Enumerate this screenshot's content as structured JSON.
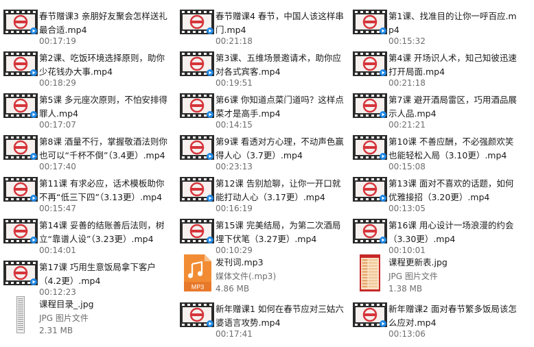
{
  "window": {
    "view": "large-icons"
  },
  "colors": {
    "text": "#1a1a1a",
    "meta": "#6d6d6d",
    "film": "#2a2a2a",
    "mp3": "#e8792a",
    "accent": "#d6343a"
  },
  "videos": [
    {
      "name": "春节赠课3 亲朋好友聚会怎样送礼最合适.mp4",
      "duration": "00:17:19"
    },
    {
      "name": "春节赠课4 春节，中国人该这样串门.mp4",
      "duration": "00:21:18"
    },
    {
      "name": "第1课、找准目的让你一呼百应.mp4",
      "duration": "00:15:32"
    },
    {
      "name": "第2课、吃饭环境选择原则，助你少花钱办大事.mp4",
      "duration": "00:18:29"
    },
    {
      "name": "第3课、五维场景邀请术，助你应对各式宾客.mp4",
      "duration": "00:19:51"
    },
    {
      "name": "第4课 开场识人术，知己知彼迅速打开局面.mp4",
      "duration": "00:21:18"
    },
    {
      "name": "第5课 多元座次原则，不怕安排得罪人.mp4",
      "duration": "00:17:07"
    },
    {
      "name": "第6课 你知道点菜门道吗？这样点菜才是高手.mp4",
      "duration": "00:14:15"
    },
    {
      "name": "第7课 避开酒局雷区，巧用酒品展示人品.mp4",
      "duration": "00:21:21"
    },
    {
      "name": "第8课 酒量不行，掌握敬酒法则你也可以“千杯不倒”（3.4更）.mp4",
      "duration": "00:17:40"
    },
    {
      "name": "第9课 看透对方心理，不动声色赢得人心（3.7更）.mp4",
      "duration": "00:23:13"
    },
    {
      "name": "第10课 不善应酬，不必强颜欢笑也能轻松入局（3.10更）.mp4",
      "duration": "00:15:08"
    },
    {
      "name": "第11课 有求必应，话术模板助你不再“低三下四”（3.13更）.mp4",
      "duration": "00:15:47"
    },
    {
      "name": "第12课 告别尬聊，让你一开口就能打动人心（3.17更）.mp4",
      "duration": "00:16:19"
    },
    {
      "name": "第13课 面对不喜欢的话题，如何优雅接招（3.20更）.mp4",
      "duration": "00:13:05"
    },
    {
      "name": "第14课 妥善的结账善后法则，树立“靠谱人设”（3.23更）.mp4",
      "duration": "00:14:01"
    },
    {
      "name": "第15课 完美结局，为第二次酒局埋下伏笔（3.27更）.mp4",
      "duration": "00:10:29"
    },
    {
      "name": "第16课 用心设计一场浪漫的约会（3.30更）.mp4",
      "duration": "00:10:01"
    },
    {
      "name": "第17课 巧用生意饭局拿下客户（4.2更）.mp4",
      "duration": "00:12:23"
    }
  ],
  "files": [
    {
      "name": "发刊词.mp3",
      "type": "媒体文件(.mp3)",
      "size": "4.86 MB",
      "icon": "mp3-icon",
      "badge": "MP3"
    },
    {
      "name": "课程更新表.jpg",
      "type": "JPG 图片文件",
      "size": "1.38 MB",
      "icon": "image-schedule-icon"
    },
    {
      "name": "课程目录_.jpg",
      "type": "JPG 图片文件",
      "size": "2.31 MB",
      "icon": "image-list-icon"
    }
  ],
  "new_year": [
    {
      "name": "新年赠课1 如何在春节应对三姑六婆语言攻势.mp4",
      "duration": "00:17:41"
    },
    {
      "name": "新年赠课2 面对春节繁多饭局该怎么应对.mp4",
      "duration": "00:13:06"
    }
  ]
}
